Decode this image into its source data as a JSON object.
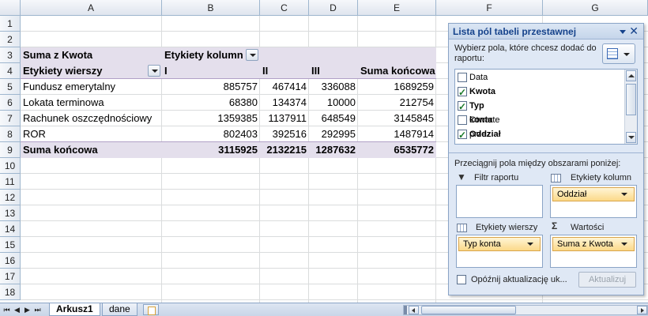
{
  "columns": [
    "A",
    "B",
    "C",
    "D",
    "E",
    "F",
    "G"
  ],
  "rows": [
    "1",
    "2",
    "3",
    "4",
    "5",
    "6",
    "7",
    "8",
    "9",
    "10",
    "11",
    "12",
    "13",
    "14",
    "15",
    "16",
    "17",
    "18"
  ],
  "pivot": {
    "value_field": "Suma z Kwota",
    "col_labels_header": "Etykiety kolumn",
    "row_labels_header": "Etykiety wierszy",
    "col_headers": [
      "I",
      "II",
      "III",
      "Suma końcowa"
    ],
    "rows": [
      {
        "label": "Fundusz emerytalny",
        "values": [
          "885757",
          "467414",
          "336088",
          "1689259"
        ]
      },
      {
        "label": "Lokata terminowa",
        "values": [
          "68380",
          "134374",
          "10000",
          "212754"
        ]
      },
      {
        "label": "Rachunek oszczędnościowy",
        "values": [
          "1359385",
          "1137911",
          "648549",
          "3145845"
        ]
      },
      {
        "label": "ROR",
        "values": [
          "802403",
          "392516",
          "292995",
          "1487914"
        ]
      }
    ],
    "total_row": {
      "label": "Suma końcowa",
      "values": [
        "3115925",
        "2132215",
        "1287632",
        "6535772"
      ]
    }
  },
  "panel": {
    "title": "Lista pól tabeli przestawnej",
    "choose_label": "Wybierz pola, które chcesz dodać do raportu:",
    "fields": [
      {
        "label": "Data",
        "checked": false,
        "bold": false
      },
      {
        "label": "Kwota",
        "checked": true,
        "bold": true
      },
      {
        "label": "Typ konta",
        "checked": true,
        "bold": true
      },
      {
        "label": "Otwarte przez",
        "checked": false,
        "bold": false
      },
      {
        "label": "Oddział",
        "checked": true,
        "bold": true
      }
    ],
    "drag_label": "Przeciągnij pola między obszarami poniżej:",
    "areas": {
      "filter_label": "Filtr raportu",
      "columns_label": "Etykiety kolumn",
      "columns_chip": "Oddział",
      "rows_label": "Etykiety wierszy",
      "rows_chip": "Typ konta",
      "values_label": "Wartości",
      "values_chip": "Suma z Kwota"
    },
    "defer_label": "Opóźnij aktualizację uk...",
    "update_button": "Aktualizuj"
  },
  "sheets": [
    "Arkusz1",
    "dane"
  ],
  "active_sheet": "Arkusz1"
}
